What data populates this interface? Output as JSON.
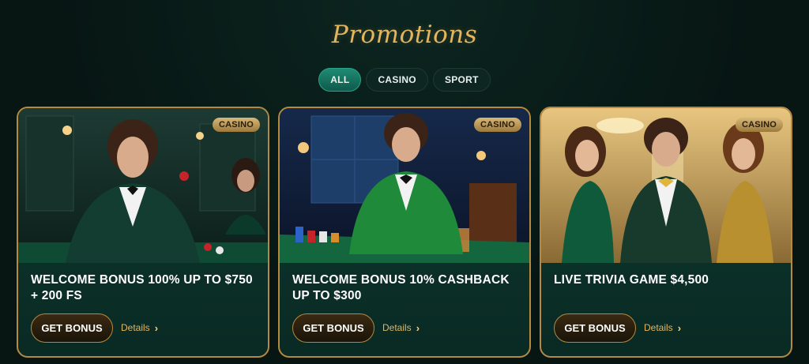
{
  "page": {
    "title": "Promotions"
  },
  "tabs": [
    {
      "label": "ALL",
      "active": true
    },
    {
      "label": "CASINO",
      "active": false
    },
    {
      "label": "SPORT",
      "active": false
    }
  ],
  "cards": [
    {
      "badge": "CASINO",
      "title_line1": "WELCOME BONUS 100% UP TO $750",
      "title_line2": "+ 200 FS",
      "cta": "GET BONUS",
      "details": "Details"
    },
    {
      "badge": "CASINO",
      "title_line1": "WELCOME BONUS 10% CASHBACK",
      "title_line2": "UP TO $300",
      "cta": "GET BONUS",
      "details": "Details"
    },
    {
      "badge": "CASINO",
      "title_line1": "LIVE TRIVIA GAME $4,500",
      "title_line2": "",
      "cta": "GET BONUS",
      "details": "Details"
    }
  ],
  "colors": {
    "background": "#071613",
    "accent_gold": "#e2b55f",
    "card_border": "#b58a40",
    "active_tab": "#1f8b74"
  },
  "icons": {
    "details_arrow": "chevron-right-icon"
  }
}
